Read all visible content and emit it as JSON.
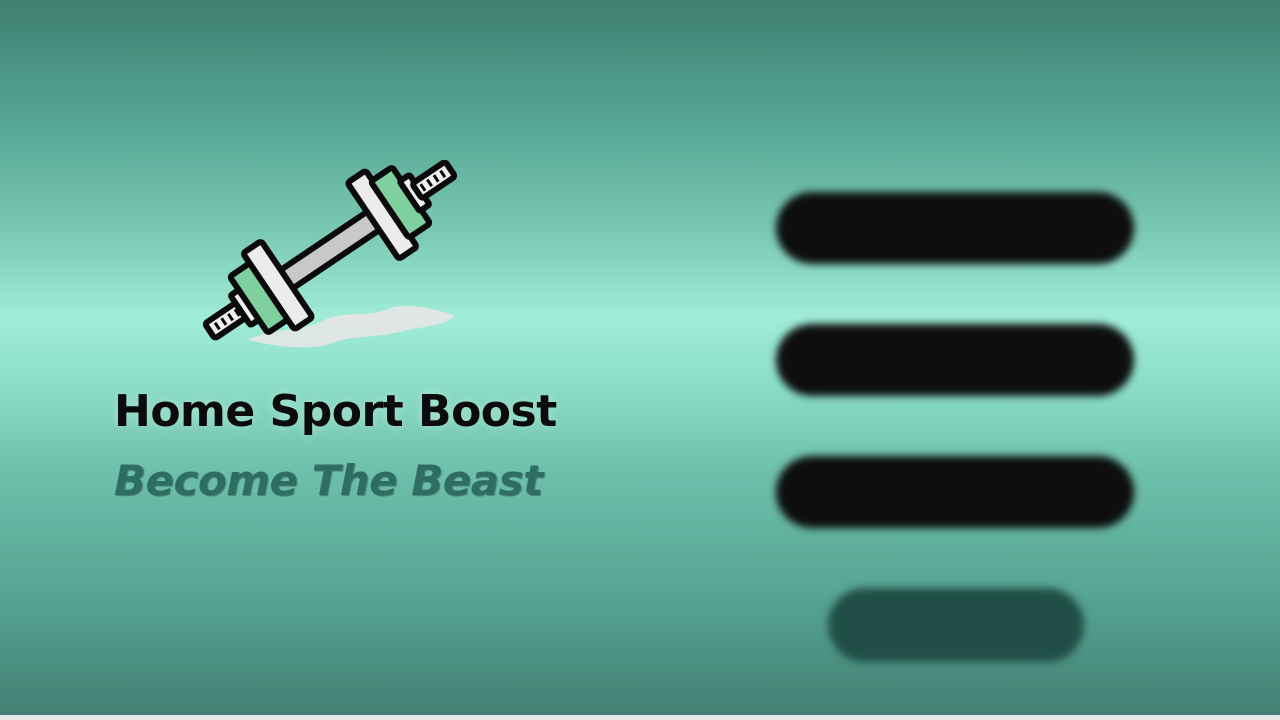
{
  "app": {
    "title": "Home Sport Boost",
    "tagline": "Become The Beast"
  },
  "logo": {
    "icon": "dumbbell-icon"
  },
  "menu": {
    "icon": "hamburger-menu-icon",
    "bars": 4
  },
  "colors": {
    "background_light": "#a0ecd8",
    "background_dark": "#3e7f70",
    "tagline": "#2e6e62",
    "title": "#0b0b0b",
    "dumbbell_plate_accent": "#7fcf9f",
    "menu_bar": "#0e0e0e",
    "menu_bar_last": "#214f47"
  }
}
